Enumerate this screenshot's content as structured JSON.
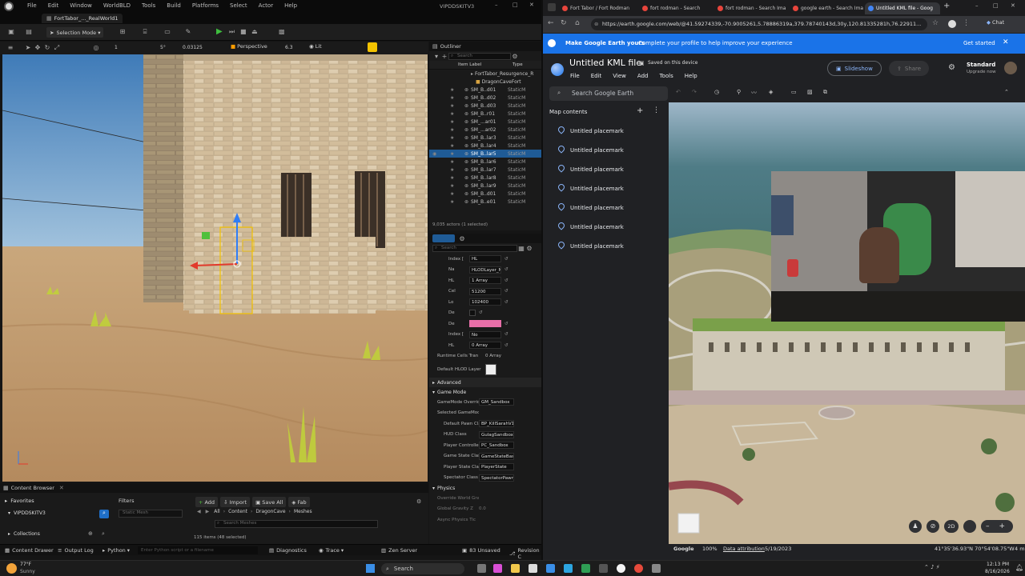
{
  "ue": {
    "menu": [
      "File",
      "Edit",
      "Window",
      "WorldBLD",
      "Tools",
      "Build",
      "Platforms",
      "Select",
      "Actor",
      "Help"
    ],
    "project_title": "VIPDDSKITV3",
    "level_tab": "FortTabor_..._RealWorld1",
    "selection_mode": "Selection Mode",
    "viewport": {
      "perspective": "Perspective",
      "lit": "Lit",
      "grid_value": "5°",
      "snap_value": "0.03125",
      "scale_value": "6.3",
      "cam_value": "1",
      "rot_value": "10"
    },
    "outliner": {
      "title": "Outliner",
      "search_placeholder": "Search",
      "col_label": "Item Label",
      "col_type": "Type",
      "root": "FortTabor_Resurgence_R",
      "folder": "DragonCaveFort",
      "rows": [
        {
          "label": "SM_B..d01",
          "type": "StaticM"
        },
        {
          "label": "SM_B..d02",
          "type": "StaticM"
        },
        {
          "label": "SM_B..d03",
          "type": "StaticM"
        },
        {
          "label": "SM_B..r01",
          "type": "StaticM"
        },
        {
          "label": "SM_...ar01",
          "type": "StaticM"
        },
        {
          "label": "SM_...ar02",
          "type": "StaticM"
        },
        {
          "label": "SM_B..lar3",
          "type": "StaticM"
        },
        {
          "label": "SM_B..lar4",
          "type": "StaticM"
        },
        {
          "label": "SM_B..lar5",
          "type": "StaticM"
        },
        {
          "label": "SM_B..lar6",
          "type": "StaticM"
        },
        {
          "label": "SM_B..lar7",
          "type": "StaticM"
        },
        {
          "label": "SM_B..lar8",
          "type": "StaticM"
        },
        {
          "label": "SM_B..lar9",
          "type": "StaticM"
        },
        {
          "label": "SM_B..d01",
          "type": "StaticM"
        },
        {
          "label": "SM_B..e01",
          "type": "StaticM"
        }
      ],
      "selected_index": 8,
      "count": "9,035 actors (1 selected)"
    },
    "details": {
      "search_placeholder": "Search",
      "rows1": [
        {
          "k": "Index [",
          "v": "HL"
        },
        {
          "k": "Na",
          "v": "HLODLayer_Mi"
        },
        {
          "k": "HL",
          "v": "1 Array"
        },
        {
          "k": "Cel",
          "v": "51200"
        },
        {
          "k": "Lo",
          "v": "102400"
        },
        {
          "k": "De",
          "v": ""
        },
        {
          "k": "De",
          "v": ""
        },
        {
          "k": "Index [",
          "v": "No"
        },
        {
          "k": "HL",
          "v": "0 Array"
        }
      ],
      "runtime_cells": "Runtime Cells Tran",
      "runtime_value": "0 Array",
      "default_hlod": "Default HLOD Layer",
      "advanced": "Advanced",
      "game_mode": "Game Mode",
      "gm_override": "GameMode Override",
      "gm_override_value": "GM_Sandbox",
      "selected_gm": "Selected GameMode",
      "gm_rows": [
        {
          "k": "Default Pawn Clas",
          "v": "BP_KillSarahV1"
        },
        {
          "k": "HUD Class",
          "v": "GulagSandboxHU"
        },
        {
          "k": "Player Controller C",
          "v": "PC_Sandbox"
        },
        {
          "k": "Game State Class",
          "v": "GameStateBase"
        },
        {
          "k": "Player State Class",
          "v": "PlayerState"
        },
        {
          "k": "Spectator Class",
          "v": "SpectatorPawn"
        }
      ],
      "physics": "Physics",
      "physics_rows": [
        {
          "k": "Override World Gra",
          "v": ""
        },
        {
          "k": "Global Gravity Z",
          "v": "0.0"
        },
        {
          "k": "Async Physics Tic",
          "v": ""
        }
      ]
    },
    "content_browser": {
      "title": "Content Browser",
      "add": "Add",
      "import": "Import",
      "save_all": "Save All",
      "fab": "Fab",
      "favorites": "Favorites",
      "project": "VIPDDSKITV3",
      "collections": "Collections",
      "filters": "Filters",
      "filter_chip": "Static Mesh",
      "path": [
        "All",
        "Content",
        "DragonCave",
        "Meshes"
      ],
      "search_placeholder": "Search Meshes",
      "items_status": "115 items (48 selected)"
    },
    "status": {
      "content_drawer": "Content Drawer",
      "output_log": "Output Log",
      "python": "Python",
      "cmd_placeholder": "Enter Python script or a filename",
      "diagnostics": "Diagnostics",
      "trace": "Trace",
      "zen": "Zen Server",
      "unsaved": "83 Unsaved",
      "revision": "Revision C"
    }
  },
  "chrome": {
    "tabs": [
      {
        "title": "Fort Tabor / Fort Rodman",
        "color": "#e8453c"
      },
      {
        "title": "fort rodman - Search",
        "color": "#e8453c"
      },
      {
        "title": "fort rodman - Search Ima",
        "color": "#e8453c"
      },
      {
        "title": "google earth - Search Ima",
        "color": "#e8453c"
      },
      {
        "title": "Untitled KML file - Goog",
        "color": "#4285f4"
      }
    ],
    "url": "https://earth.google.com/web/@41.59274339,-70.9005261,5.78886319a,379.78740143d,30y,120.81335281h,76.22911...",
    "chat_label": "Chat"
  },
  "earth": {
    "banner_title": "Make Google Earth yours",
    "banner_text": "Complete your profile to help improve your experience",
    "banner_action": "Get started",
    "file_title": "Untitled KML file",
    "saved": "Saved on this device",
    "menu": [
      "File",
      "Edit",
      "View",
      "Add",
      "Tools",
      "Help"
    ],
    "slideshow": "Slideshow",
    "share": "Share",
    "plan": "Standard",
    "upgrade": "Upgrade now",
    "search_placeholder": "Search Google Earth",
    "map_contents": "Map contents",
    "placemarks": [
      "Untitled placemark",
      "Untitled placemark",
      "Untitled placemark",
      "Untitled placemark",
      "Untitled placemark",
      "Untitled placemark",
      "Untitled placemark"
    ],
    "footer": {
      "brand": "Google",
      "zoom": "100%",
      "attribution": "Data attribution",
      "date": "5/19/2023",
      "coords": "41°35'36.93\"N 70°54'08.75\"W",
      "alt": "4 m"
    },
    "mode_2d": "2D"
  },
  "taskbar": {
    "weather_temp": "77°F",
    "weather_cond": "Sunny",
    "search": "Search",
    "time": "12:13 PM",
    "date": "8/16/2026"
  }
}
